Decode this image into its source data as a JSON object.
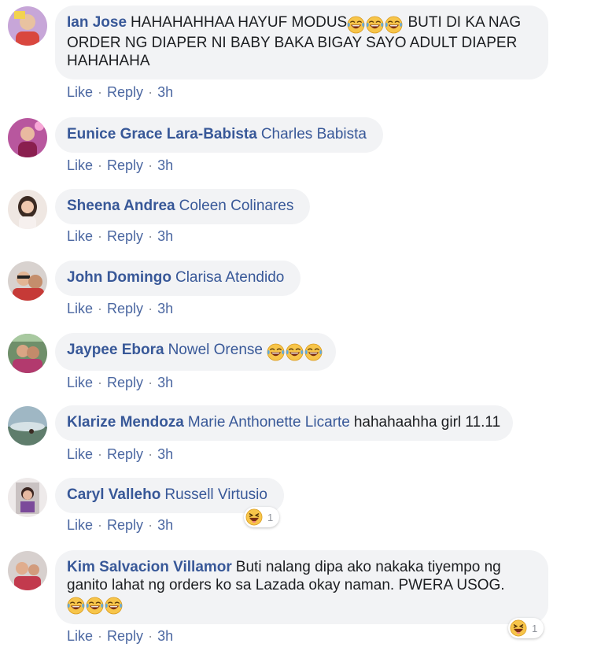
{
  "comments": [
    {
      "author": "Ian Jose",
      "mention": "",
      "text_before": "HAHAHAHHAA HAYUF MODUS",
      "text_after": " BUTI DI KA NAG ORDER NG DIAPER NI BABY BAKA BIGAY SAYO ADULT DIAPER HAHAHAHA",
      "emoji": "laughing-tears-emoji",
      "like": "Like",
      "reply": "Reply",
      "time": "3h"
    },
    {
      "author": "Eunice Grace Lara-Babista",
      "mention": "Charles Babista",
      "like": "Like",
      "reply": "Reply",
      "time": "3h"
    },
    {
      "author": "Sheena Andrea",
      "mention": "Coleen Colinares",
      "like": "Like",
      "reply": "Reply",
      "time": "3h"
    },
    {
      "author": "John Domingo",
      "mention": "Clarisa Atendido",
      "like": "Like",
      "reply": "Reply",
      "time": "3h"
    },
    {
      "author": "Jaypee Ebora",
      "mention": "Nowel Orense",
      "like": "Like",
      "reply": "Reply",
      "time": "3h"
    },
    {
      "author": "Klarize Mendoza",
      "mention": "Marie Anthonette Licarte",
      "text": "hahahaahha girl 11.11",
      "like": "Like",
      "reply": "Reply",
      "time": "3h"
    },
    {
      "author": "Caryl Valleho",
      "mention": "Russell Virtusio",
      "like": "Like",
      "reply": "Reply",
      "time": "3h",
      "reaction_count": "1"
    },
    {
      "author": "Kim Salvacion Villamor",
      "text": "Buti nalang dipa ako nakaka tiyempo ng ganito lahat ng orders ko sa Lazada okay naman. PWERA USOG.",
      "like": "Like",
      "reply": "Reply",
      "time": "3h",
      "reaction_count": "1"
    }
  ],
  "separator": "·",
  "colors": {
    "author": "#385898",
    "bubble": "#f2f3f5",
    "link": "#4b67a1",
    "dot": "#90949c"
  }
}
